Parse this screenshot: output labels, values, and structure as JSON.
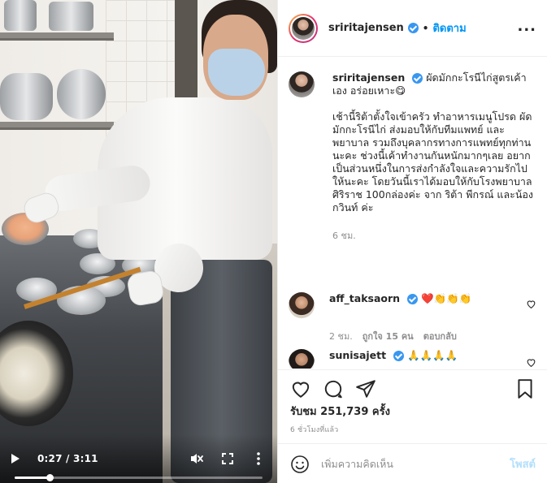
{
  "video": {
    "current_time": "0:27",
    "duration": "3:11",
    "progress": 0.14,
    "controls": [
      "play-icon",
      "mute-icon",
      "fullscreen-icon",
      "more-icon"
    ]
  },
  "header": {
    "username": "sriritajensen",
    "separator": "•",
    "follow_label": "ติดตาม",
    "more_label": "..."
  },
  "caption": {
    "username": "sriritajensen",
    "title": "ผัดมักกะโรนีไก่สูตรเค้าเอง อร่อยเหาะ😋",
    "body": "เช้านี้ริต้าตั้งใจเข้าครัว ทำอาหารเมนูโปรด ผัดมักกะโรนีไก่ ส่งมอบให้กับทีมแพทย์ และพยาบาล รวมถึงบุคลากรทางการแพทย์ทุกท่านนะคะ ช่วงนี้เค้าทำงานกันหนักมากๆเลย อยากเป็นส่วนหนึ่งในการส่งกำลังใจและความรักไปให้นะคะ โดยวันนี้เราได้มอบให้กับโรงพยาบาลศิริราช 100กล่องค่ะ จาก ริต้า พีกรณ์ และน้องกวินท์ ค่ะ",
    "time": "6 ชม."
  },
  "comments": [
    {
      "username": "aff_taksaorn",
      "text": "❤️👏👏👏",
      "time": "2 ชม.",
      "likes": "ถูกใจ 15 คน",
      "reply_label": "ตอบกลับ"
    },
    {
      "username": "sunisajett",
      "text": "🙏🙏🙏🙏"
    }
  ],
  "actions": {
    "likes_text": "รับชม 251,739 ครั้ง",
    "ago_text": "6 ชั่วโมงที่แล้ว",
    "comment_placeholder": "เพิ่มความคิดเห็น",
    "post_label": "โพสต์"
  },
  "colors": {
    "accent": "#0095f6",
    "verified": "#3897f0",
    "muted_text": "#8e8e8e",
    "post_disabled": "#b2dffc",
    "heart_red": "#ed4956"
  }
}
